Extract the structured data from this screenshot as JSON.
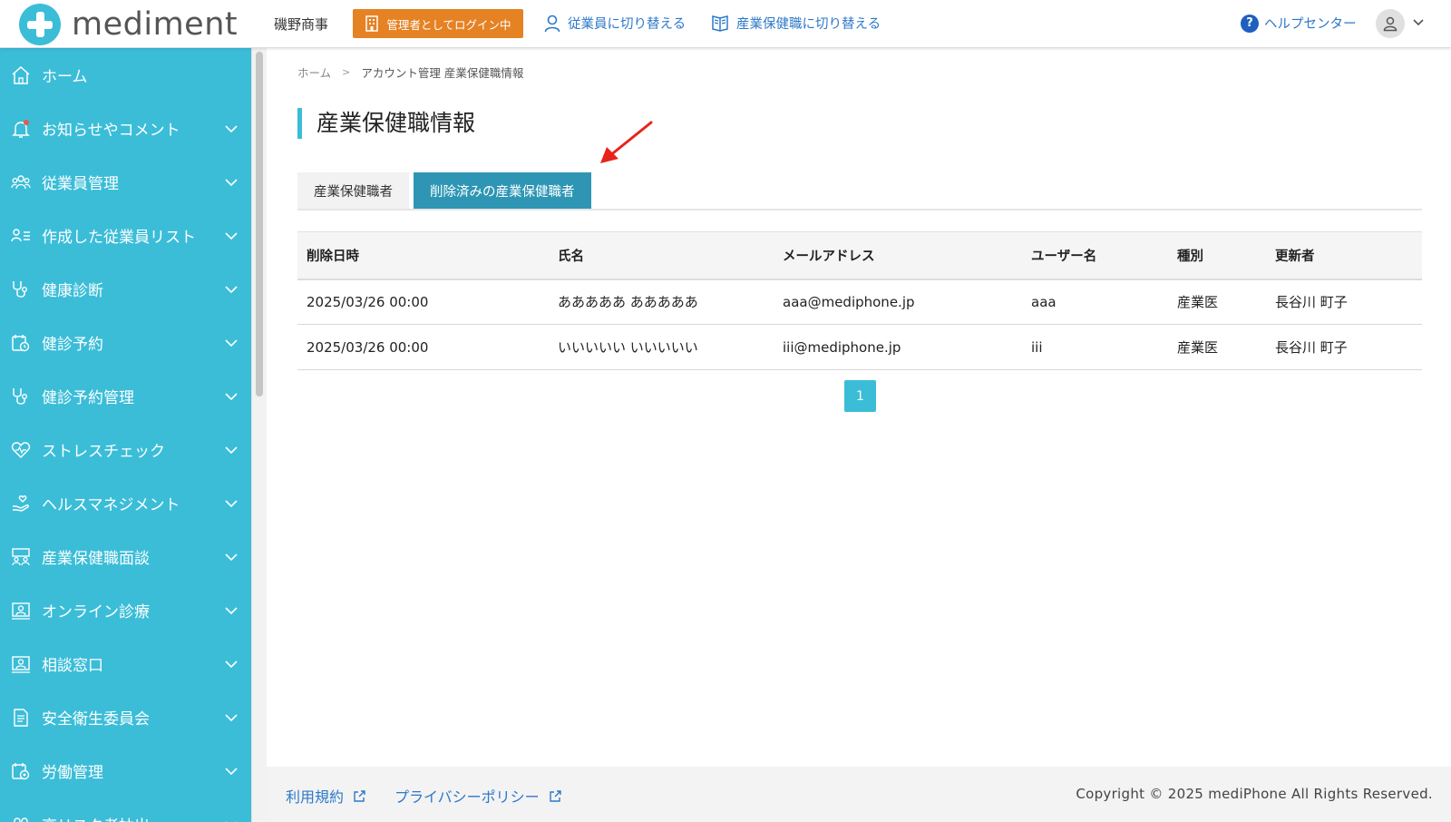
{
  "header": {
    "logo_text": "mediment",
    "company": "磯野商事",
    "admin_badge": "管理者としてログイン中",
    "switch_employee": "従業員に切り替える",
    "switch_oh": "産業保健職に切り替える",
    "help": "ヘルプセンター"
  },
  "sidebar": {
    "items": [
      {
        "label": "ホーム",
        "icon": "home-icon"
      },
      {
        "label": "お知らせやコメント",
        "icon": "bell-icon"
      },
      {
        "label": "従業員管理",
        "icon": "people-icon"
      },
      {
        "label": "作成した従業員リスト",
        "icon": "user-list-icon"
      },
      {
        "label": "健康診断",
        "icon": "stethoscope-icon"
      },
      {
        "label": "健診予約",
        "icon": "calendar-clock-icon"
      },
      {
        "label": "健診予約管理",
        "icon": "stethoscope-icon"
      },
      {
        "label": "ストレスチェック",
        "icon": "heart-icon"
      },
      {
        "label": "ヘルスマネジメント",
        "icon": "hand-heart-icon"
      },
      {
        "label": "産業保健職面談",
        "icon": "meeting-icon"
      },
      {
        "label": "オンライン診療",
        "icon": "monitor-user-icon"
      },
      {
        "label": "相談窓口",
        "icon": "monitor-user-icon"
      },
      {
        "label": "安全衛生委員会",
        "icon": "document-icon"
      },
      {
        "label": "労働管理",
        "icon": "calendar-gear-icon"
      },
      {
        "label": "高リスク者抽出",
        "icon": "users-icon"
      }
    ]
  },
  "breadcrumb": {
    "home": "ホーム",
    "current": "アカウント管理 産業保健職情報"
  },
  "page": {
    "title": "産業保健職情報"
  },
  "tabs": [
    {
      "label": "産業保健職者",
      "active": false
    },
    {
      "label": "削除済みの産業保健職者",
      "active": true
    }
  ],
  "table": {
    "headers": [
      "削除日時",
      "氏名",
      "メールアドレス",
      "ユーザー名",
      "種別",
      "更新者"
    ],
    "rows": [
      [
        "2025/03/26 00:00",
        "あああああ あああああ",
        "aaa@mediphone.jp",
        "aaa",
        "産業医",
        "長谷川 町子"
      ],
      [
        "2025/03/26 00:00",
        "いいいいい いいいいい",
        "iii@mediphone.jp",
        "iii",
        "産業医",
        "長谷川 町子"
      ]
    ]
  },
  "pagination": {
    "current_page": "1"
  },
  "footer": {
    "terms": "利用規約",
    "privacy": "プライバシーポリシー",
    "copyright": "Copyright © 2025 mediPhone All Rights Reserved."
  },
  "colors": {
    "sidebar_bg": "#3bbdd8",
    "active_tab": "#2e96b4",
    "admin_badge": "#e58224",
    "link": "#2d78c8",
    "annotation_arrow": "#e8231a"
  }
}
